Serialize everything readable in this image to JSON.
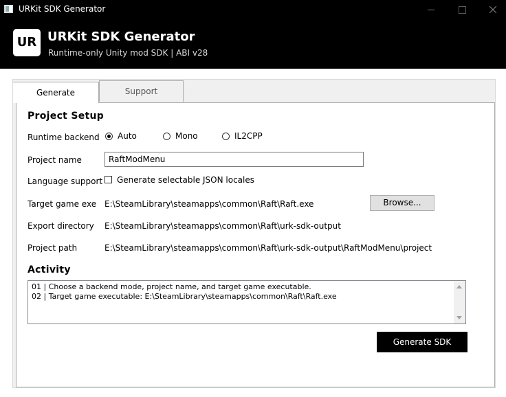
{
  "window": {
    "title": "URKit SDK Generator"
  },
  "header": {
    "logo_text": "UR",
    "title": "URKit SDK Generator",
    "subtitle": "Runtime-only Unity mod SDK | ABI v28"
  },
  "tabs": [
    {
      "label": "Generate",
      "selected": true
    },
    {
      "label": "Support",
      "selected": false
    }
  ],
  "project_setup": {
    "heading": "Project Setup",
    "runtime_backend": {
      "label": "Runtime backend",
      "options": [
        "Auto",
        "Mono",
        "IL2CPP"
      ],
      "selected": "Auto"
    },
    "project_name": {
      "label": "Project name",
      "value": "RaftModMenu"
    },
    "language_support": {
      "label": "Language support",
      "checkbox_label": "Generate selectable JSON locales",
      "checked": false
    },
    "target_game_exe": {
      "label": "Target game exe",
      "value": "E:\\SteamLibrary\\steamapps\\common\\Raft\\Raft.exe",
      "browse_label": "Browse..."
    },
    "export_directory": {
      "label": "Export directory",
      "value": "E:\\SteamLibrary\\steamapps\\common\\Raft\\urk-sdk-output"
    },
    "project_path": {
      "label": "Project path",
      "value": "E:\\SteamLibrary\\steamapps\\common\\Raft\\urk-sdk-output\\RaftModMenu\\project"
    }
  },
  "activity": {
    "heading": "Activity",
    "lines": [
      "01 | Choose a backend mode, project name, and target game executable.",
      "02 | Target game executable: E:\\SteamLibrary\\steamapps\\common\\Raft\\Raft.exe"
    ]
  },
  "actions": {
    "generate_label": "Generate SDK"
  }
}
